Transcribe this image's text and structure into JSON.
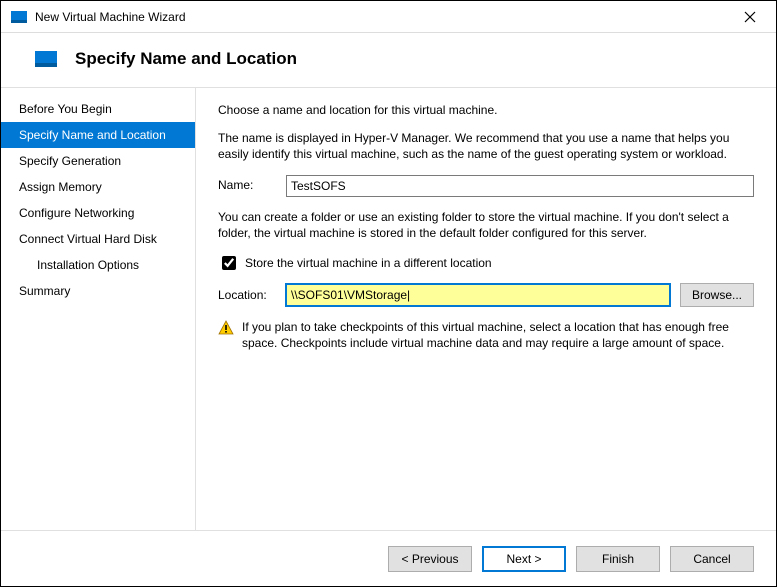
{
  "window": {
    "title": "New Virtual Machine Wizard"
  },
  "header": {
    "title": "Specify Name and Location"
  },
  "sidebar": {
    "items": [
      {
        "label": "Before You Begin"
      },
      {
        "label": "Specify Name and Location"
      },
      {
        "label": "Specify Generation"
      },
      {
        "label": "Assign Memory"
      },
      {
        "label": "Configure Networking"
      },
      {
        "label": "Connect Virtual Hard Disk"
      },
      {
        "label": "Installation Options"
      },
      {
        "label": "Summary"
      }
    ],
    "selected_index": 1
  },
  "content": {
    "intro": "Choose a name and location for this virtual machine.",
    "name_help": "The name is displayed in Hyper-V Manager. We recommend that you use a name that helps you easily identify this virtual machine, such as the name of the guest operating system or workload.",
    "name_label": "Name:",
    "name_value": "TestSOFS",
    "loc_help": "You can create a folder or use an existing folder to store the virtual machine. If you don't select a folder, the virtual machine is stored in the default folder configured for this server.",
    "store_checkbox_label": "Store the virtual machine in a different location",
    "store_checked": true,
    "location_label": "Location:",
    "location_value": "\\\\SOFS01\\VMStorage|",
    "browse_label": "Browse...",
    "warning_text": "If you plan to take checkpoints of this virtual machine, select a location that has enough free space. Checkpoints include virtual machine data and may require a large amount of space."
  },
  "footer": {
    "previous": "< Previous",
    "next": "Next >",
    "finish": "Finish",
    "cancel": "Cancel"
  }
}
